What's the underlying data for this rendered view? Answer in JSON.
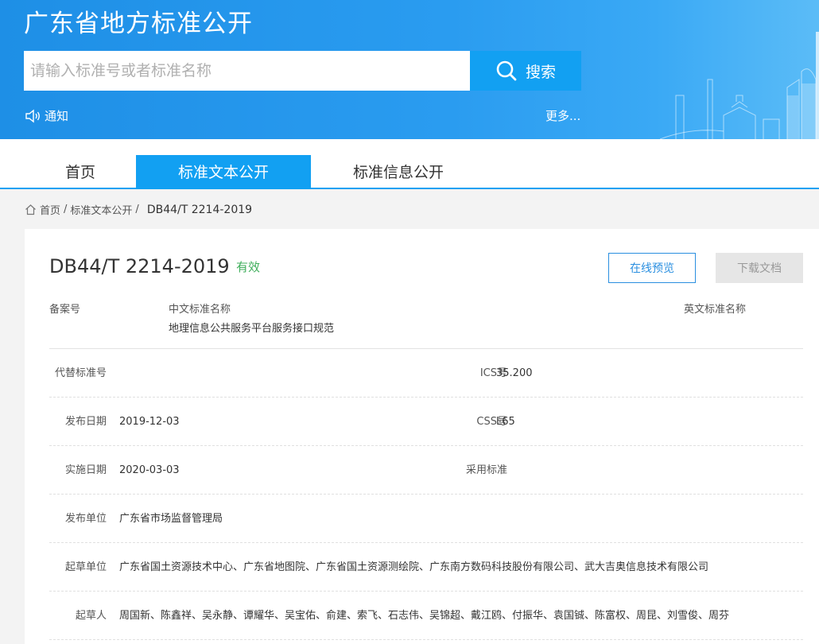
{
  "header": {
    "site_title": "广东省地方标准公开",
    "search_placeholder": "请输入标准号或者标准名称",
    "search_button": "搜索",
    "notice": "通知",
    "more": "更多..."
  },
  "nav": {
    "tabs": [
      {
        "label": "首页"
      },
      {
        "label": "标准文本公开"
      },
      {
        "label": "标准信息公开"
      }
    ],
    "active_index": 1
  },
  "breadcrumb": {
    "home": "首页",
    "sep1": "/",
    "section": "标准文本公开",
    "sep2": "/",
    "current": "DB44/T 2214-2019"
  },
  "detail": {
    "standard_no": "DB44/T 2214-2019",
    "status": "有效",
    "preview_button": "在线预览",
    "download_button": "下载文档",
    "record_no_label": "备案号",
    "cn_name_label": "中文标准名称",
    "cn_name": "地理信息公共服务平台服务接口规范",
    "en_name_label": "英文标准名称",
    "fields": {
      "replaced_label": "代替标准号",
      "replaced": "",
      "ics_label": "ICS号",
      "ics": "35.200",
      "publish_date_label": "发布日期",
      "publish_date": "2019-12-03",
      "css_label": "CSS号",
      "css": "L65",
      "effective_date_label": "实施日期",
      "effective_date": "2020-03-03",
      "adopted_label": "采用标准",
      "adopted": "",
      "publisher_label": "发布单位",
      "publisher": "广东省市场监督管理局",
      "drafting_unit_label": "起草单位",
      "drafting_unit": "广东省国土资源技术中心、广东省地图院、广东省国土资源测绘院、广东南方数码科技股份有限公司、武大吉奥信息技术有限公司",
      "drafter_label": "起草人",
      "drafter": "周国新、陈鑫祥、吴永静、谭耀华、吴宝佑、俞建、索飞、石志伟、吴锦超、戴江鸥、付振华、袁国铖、陈富权、周昆、刘雪俊、周芬"
    }
  },
  "colors": {
    "header_blue": "#1e8fe6",
    "accent_blue": "#12a0f2",
    "status_green": "#3fae5b",
    "disabled_gray": "#e6e6e6"
  },
  "icons": [
    "search-icon",
    "speaker-icon",
    "home-icon"
  ]
}
